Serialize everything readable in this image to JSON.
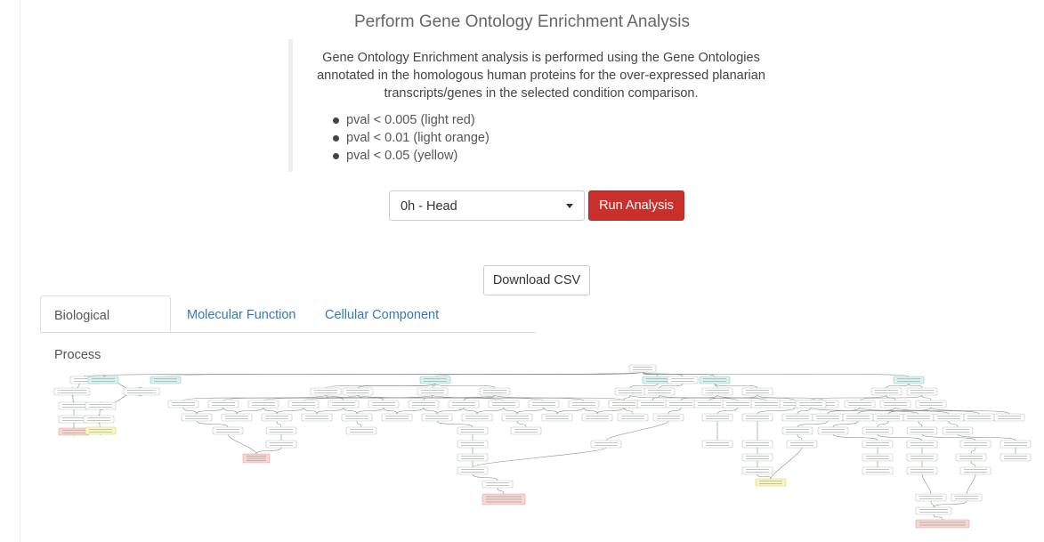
{
  "header": {
    "title": "Perform Gene Ontology Enrichment Analysis"
  },
  "info": {
    "line1": "Gene Ontology Enrichment analysis is performed using the Gene Ontologies",
    "line2": "annotated in the homologous human proteins for the over-expressed planarian",
    "line3": "transcripts/genes in the selected condition comparison.",
    "legend": [
      "pval < 0.005 (light red)",
      "pval < 0.01 (light orange)",
      "pval < 0.05 (yellow)"
    ]
  },
  "controls": {
    "condition_selected": "0h - Head",
    "run_label": "Run Analysis",
    "download_label": "Download CSV"
  },
  "tabs": [
    {
      "label": "Biological Process",
      "active": true
    },
    {
      "label": "Molecular Function",
      "active": false
    },
    {
      "label": "Cellular Component",
      "active": false
    }
  ],
  "colors": {
    "accent": "#c9302c",
    "link": "#337ab7",
    "node_default": "#ffffff",
    "node_root_term": "#d8f2ef",
    "node_pval_0005": "#f9d6d2",
    "node_pval_001": "#fde3c8",
    "node_pval_005": "#fbf6c0",
    "edge": "#8a8a8a"
  },
  "graph_legend_icons": [
    "pval-red-node",
    "pval-yellow-node",
    "root-cyan-node"
  ]
}
